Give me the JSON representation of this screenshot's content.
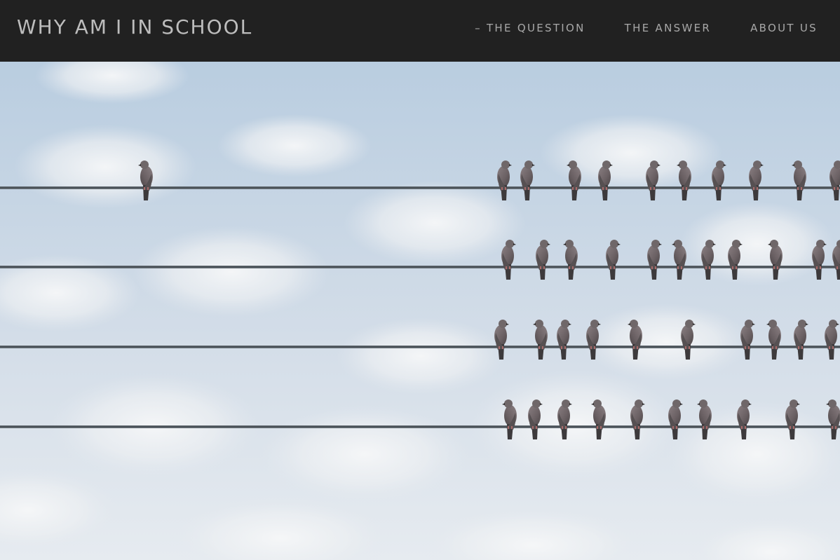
{
  "header": {
    "site_title": "WHY AM I IN SCHOOL",
    "nav": [
      {
        "label": "– THE QUESTION"
      },
      {
        "label": "THE ANSWER"
      },
      {
        "label": "ABOUT US"
      }
    ]
  },
  "hero": {
    "image_description": "pigeons-on-wires",
    "colors": {
      "sky_top": "#b9cde0",
      "sky_bottom": "#e4eaf0",
      "cloud": "#f2f4f6",
      "wire": "#4a5157",
      "bird_body": "#6e6466",
      "bird_dark": "#3d3a3c"
    }
  }
}
